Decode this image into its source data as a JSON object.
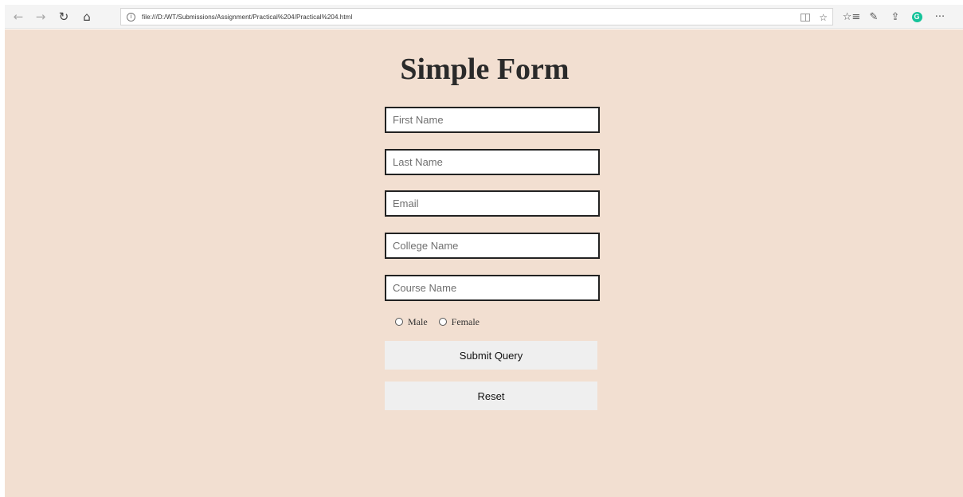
{
  "browser": {
    "back_icon": "←",
    "forward_icon": "→",
    "refresh_icon": "↻",
    "home_icon": "⌂",
    "address_url": "file:///D:/WT/Submissions/Assignment/Practical%204/Practical%204.html",
    "info_icon": "i",
    "favorite_icon": "☆",
    "favorites_list_icon": "☆≡",
    "pen_icon": "✎",
    "share_icon": "⇪",
    "extension_letter": "G",
    "more_icon": "···",
    "extension_color": "#15c39a"
  },
  "page": {
    "background_color": "#f2dfd1",
    "title": "Simple Form",
    "fields": {
      "first_name": "First Name",
      "last_name": "Last Name",
      "email": "Email",
      "college_name": "College Name",
      "course_name": "Course Name"
    },
    "gender": {
      "male": "Male",
      "female": "Female"
    },
    "submit_label": "Submit Query",
    "reset_label": "Reset"
  }
}
